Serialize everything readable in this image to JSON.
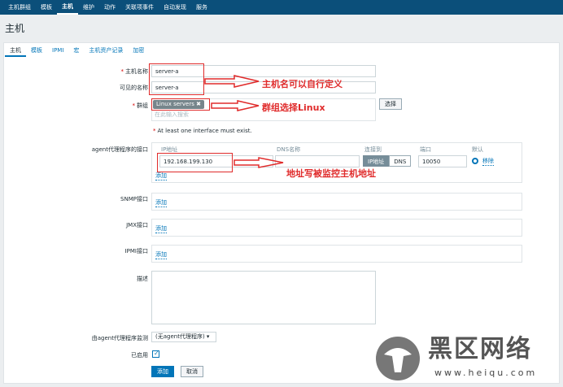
{
  "topnav": [
    "主机群组",
    "模板",
    "主机",
    "维护",
    "动作",
    "关联项事件",
    "自动发现",
    "服务"
  ],
  "page_title": "主机",
  "tabs": [
    "主机",
    "模板",
    "IPMI",
    "宏",
    "主机资产记录",
    "加密"
  ],
  "form": {
    "hostname_label": "主机名称",
    "hostname_value": "server-a",
    "visible_name_label": "可见的名称",
    "visible_name_value": "server-a",
    "groups_label": "群组",
    "group_chip": "Linux servers",
    "group_search_placeholder": "在此输入搜索",
    "select_button": "选择",
    "interface_note": "At least one interface must exist.",
    "agent_label": "agent代理程序的接口",
    "col_ip": "IP地址",
    "col_dns": "DNS名称",
    "col_connect": "连接到",
    "col_port": "端口",
    "col_default": "默认",
    "ip_value": "192.168.199.130",
    "conn_ip": "IP地址",
    "conn_dns": "DNS",
    "port_value": "10050",
    "remove_link": "移除",
    "add_link": "添加",
    "snmp_label": "SNMP接口",
    "jmx_label": "JMX接口",
    "ipmi_label": "IPMI接口",
    "desc_label": "描述",
    "proxy_label": "由agent代理程序监测",
    "proxy_value": "(无agent代理程序)",
    "enabled_label": "已启用",
    "add_button": "添加",
    "cancel_button": "取消"
  },
  "annotations": {
    "hostname_note": "主机名可以自行定义",
    "group_note": "群组选择Linux",
    "ip_note": "地址写被监控主机地址"
  },
  "watermark": {
    "brand": "黑区网络",
    "url": "www.heiqu.com"
  },
  "colors": {
    "nav": "#0b4f7a",
    "link": "#0275b8",
    "annotation": "#e02b2b"
  }
}
